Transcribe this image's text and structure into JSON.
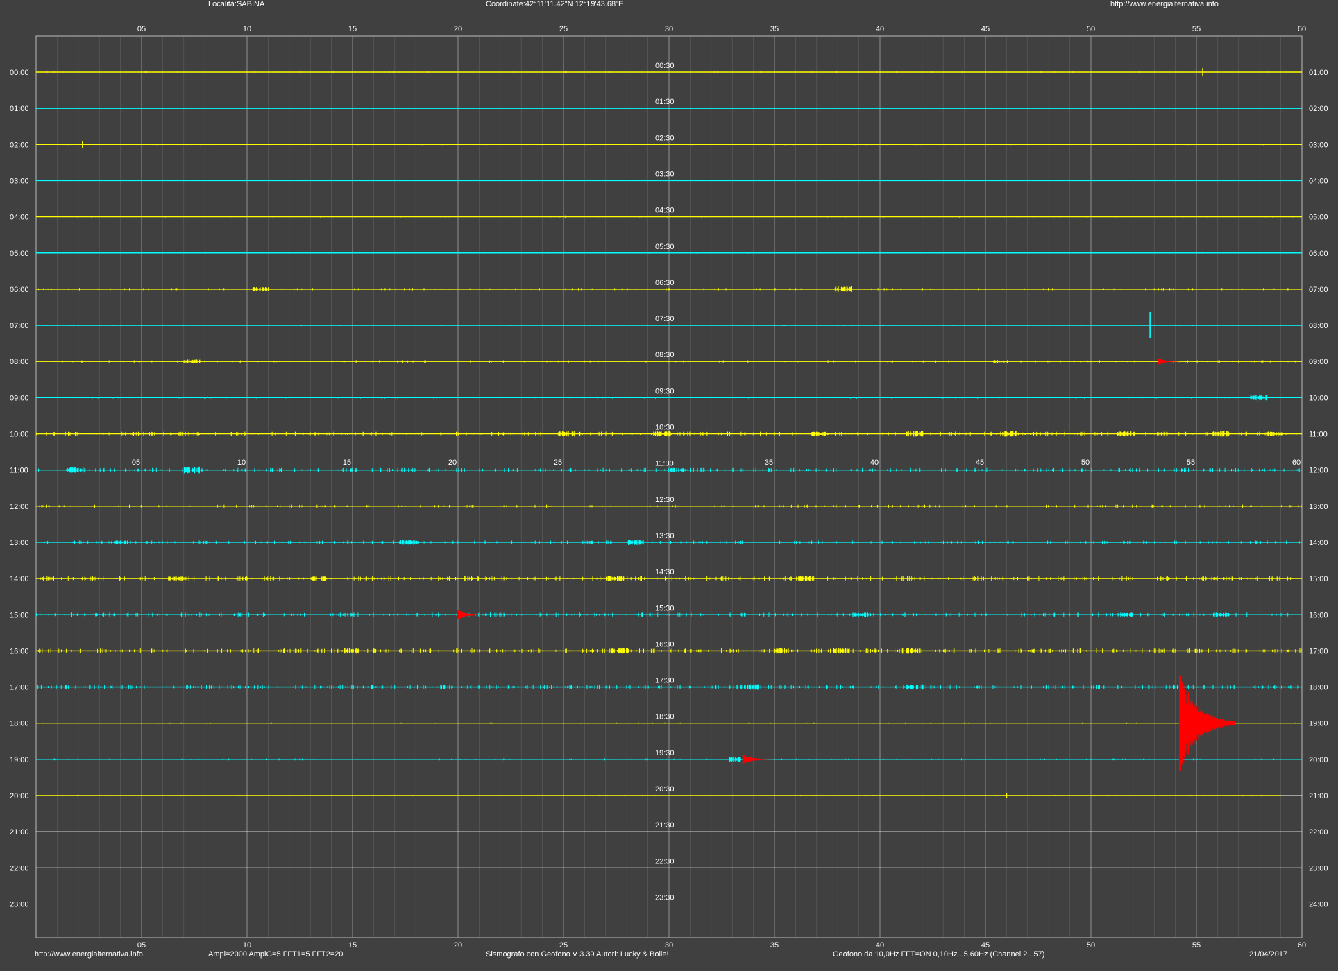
{
  "header": {
    "location": "Località:SABINA",
    "coordinates": "Coordinate:42°11'11.42\"N  12°19'43.68\"E",
    "site_url": "http://www.energialternativa.info"
  },
  "footer": {
    "site_url": "http://www.energialternativa.info",
    "amplification": "Ampl=2000 AmplG=5 FFT1=5 FFT2=20",
    "software": "Sismografo con Geofono V 3.39  Autori: Lucky & Bolle!",
    "sensor": "Geofono da 10,0Hz FFT=ON 0,10Hz...5,60Hz      (Channel 2...57)",
    "date": "21/04/2017"
  },
  "colors": {
    "background": "#404040",
    "trace_even": "#ffff00",
    "trace_odd": "#00ffff",
    "trace_future": "#ffffff",
    "event": "#ff0000",
    "grid": "#7a7a7a"
  },
  "chart_data": {
    "type": "line",
    "x_ticks": [
      "05",
      "10",
      "15",
      "20",
      "25",
      "30",
      "35",
      "40",
      "45",
      "50",
      "55",
      "60"
    ],
    "xlim": [
      0,
      60
    ],
    "left_labels": [
      "00:00",
      "01:00",
      "02:00",
      "03:00",
      "04:00",
      "05:00",
      "06:00",
      "07:00",
      "08:00",
      "09:00",
      "10:00",
      "11:00",
      "12:00",
      "13:00",
      "14:00",
      "15:00",
      "16:00",
      "17:00",
      "18:00",
      "19:00",
      "20:00",
      "21:00",
      "22:00",
      "23:00"
    ],
    "right_labels": [
      "01:00",
      "02:00",
      "03:00",
      "04:00",
      "05:00",
      "06:00",
      "07:00",
      "08:00",
      "09:00",
      "10:00",
      "11:00",
      "12:00",
      "13:00",
      "14:00",
      "15:00",
      "16:00",
      "17:00",
      "18:00",
      "19:00",
      "20:00",
      "21:00",
      "22:00",
      "23:00",
      "24:00"
    ],
    "mid_labels": [
      "00:30",
      "01:30",
      "02:30",
      "03:30",
      "04:30",
      "05:30",
      "06:30",
      "07:30",
      "08:30",
      "09:30",
      "10:30",
      "11:30",
      "12:30",
      "13:30",
      "14:30",
      "15:30",
      "16:30",
      "17:30",
      "18:30",
      "19:30",
      "20:30",
      "21:30",
      "22:30",
      "23:30"
    ],
    "recording_end": {
      "hour": 20,
      "minute": 59
    },
    "activity": [
      {
        "hour": 0,
        "level": 0.5,
        "bursts": []
      },
      {
        "hour": 1,
        "level": 0.0,
        "bursts": []
      },
      {
        "hour": 2,
        "level": 0.5,
        "bursts": []
      },
      {
        "hour": 3,
        "level": 0.0,
        "bursts": []
      },
      {
        "hour": 4,
        "level": 0.5,
        "bursts": []
      },
      {
        "hour": 5,
        "level": 0.5,
        "bursts": []
      },
      {
        "hour": 6,
        "level": 1.5,
        "bursts": [
          {
            "minute": 10.5,
            "amp": 3
          },
          {
            "minute": 38.1,
            "amp": 4
          }
        ]
      },
      {
        "hour": 7,
        "level": 0.5,
        "bursts": []
      },
      {
        "hour": 8,
        "level": 1.5,
        "bursts": [
          {
            "minute": 7.2,
            "amp": 3
          },
          {
            "minute": 45.5,
            "amp": 2
          }
        ]
      },
      {
        "hour": 9,
        "level": 1.0,
        "bursts": [
          {
            "minute": 57.8,
            "amp": 4
          }
        ]
      },
      {
        "hour": 10,
        "level": 3.0,
        "bursts": [
          {
            "minute": 25,
            "amp": 4
          },
          {
            "minute": 29.5,
            "amp": 4
          },
          {
            "minute": 37,
            "amp": 3
          },
          {
            "minute": 41.5,
            "amp": 4
          },
          {
            "minute": 46,
            "amp": 4
          },
          {
            "minute": 51.5,
            "amp": 4
          },
          {
            "minute": 56,
            "amp": 4
          },
          {
            "minute": 58.5,
            "amp": 3
          }
        ]
      },
      {
        "hour": 11,
        "level": 3.0,
        "bursts": [
          {
            "minute": 1.8,
            "amp": 4
          },
          {
            "minute": 7.2,
            "amp": 5
          },
          {
            "minute": 30.3,
            "amp": 3
          }
        ]
      },
      {
        "hour": 12,
        "level": 2.0,
        "bursts": []
      },
      {
        "hour": 13,
        "level": 2.5,
        "bursts": [
          {
            "minute": 3.8,
            "amp": 3
          },
          {
            "minute": 17.5,
            "amp": 4
          },
          {
            "minute": 28.3,
            "amp": 4
          }
        ]
      },
      {
        "hour": 14,
        "level": 3.5,
        "bursts": [
          {
            "minute": 6.5,
            "amp": 3
          },
          {
            "minute": 13.3,
            "amp": 3
          },
          {
            "minute": 27.3,
            "amp": 4
          },
          {
            "minute": 36.3,
            "amp": 4
          }
        ]
      },
      {
        "hour": 15,
        "level": 3.0,
        "bursts": [
          {
            "minute": 39,
            "amp": 3
          },
          {
            "minute": 51.5,
            "amp": 3
          },
          {
            "minute": 56,
            "amp": 3
          }
        ]
      },
      {
        "hour": 16,
        "level": 3.5,
        "bursts": [
          {
            "minute": 14.8,
            "amp": 4
          },
          {
            "minute": 27.5,
            "amp": 4
          },
          {
            "minute": 35.2,
            "amp": 4
          },
          {
            "minute": 38,
            "amp": 4
          },
          {
            "minute": 41.3,
            "amp": 4
          }
        ]
      },
      {
        "hour": 17,
        "level": 3.5,
        "bursts": [
          {
            "minute": 33.8,
            "amp": 4
          },
          {
            "minute": 41.5,
            "amp": 4
          }
        ]
      },
      {
        "hour": 18,
        "level": 0.5,
        "bursts": []
      },
      {
        "hour": 19,
        "level": 1.0,
        "bursts": [
          {
            "minute": 33.1,
            "amp": 4
          }
        ]
      },
      {
        "hour": 20,
        "level": 0.5,
        "bursts": []
      },
      {
        "hour": 21,
        "level": 0,
        "bursts": []
      },
      {
        "hour": 22,
        "level": 0,
        "bursts": []
      },
      {
        "hour": 23,
        "level": 0,
        "bursts": []
      }
    ],
    "spikes": [
      {
        "hour": 0,
        "minute": 55.3,
        "amp": 6
      },
      {
        "hour": 2,
        "minute": 2.2,
        "amp": 5
      },
      {
        "hour": 4,
        "minute": 25.1,
        "amp": 2
      },
      {
        "hour": 7,
        "minute": 52.8,
        "amp": 19
      },
      {
        "hour": 20,
        "minute": 46.0,
        "amp": 3
      }
    ],
    "events": [
      {
        "hour": 8,
        "minute": 53.2,
        "duration": 1.0,
        "amp": 5
      },
      {
        "hour": 15,
        "minute": 20.0,
        "duration": 1.2,
        "amp": 8
      },
      {
        "hour": 19,
        "minute": 33.5,
        "duration": 1.4,
        "amp": 7
      },
      {
        "hour": 18,
        "minute": 54.2,
        "duration": 2.6,
        "amp": 75
      }
    ]
  }
}
